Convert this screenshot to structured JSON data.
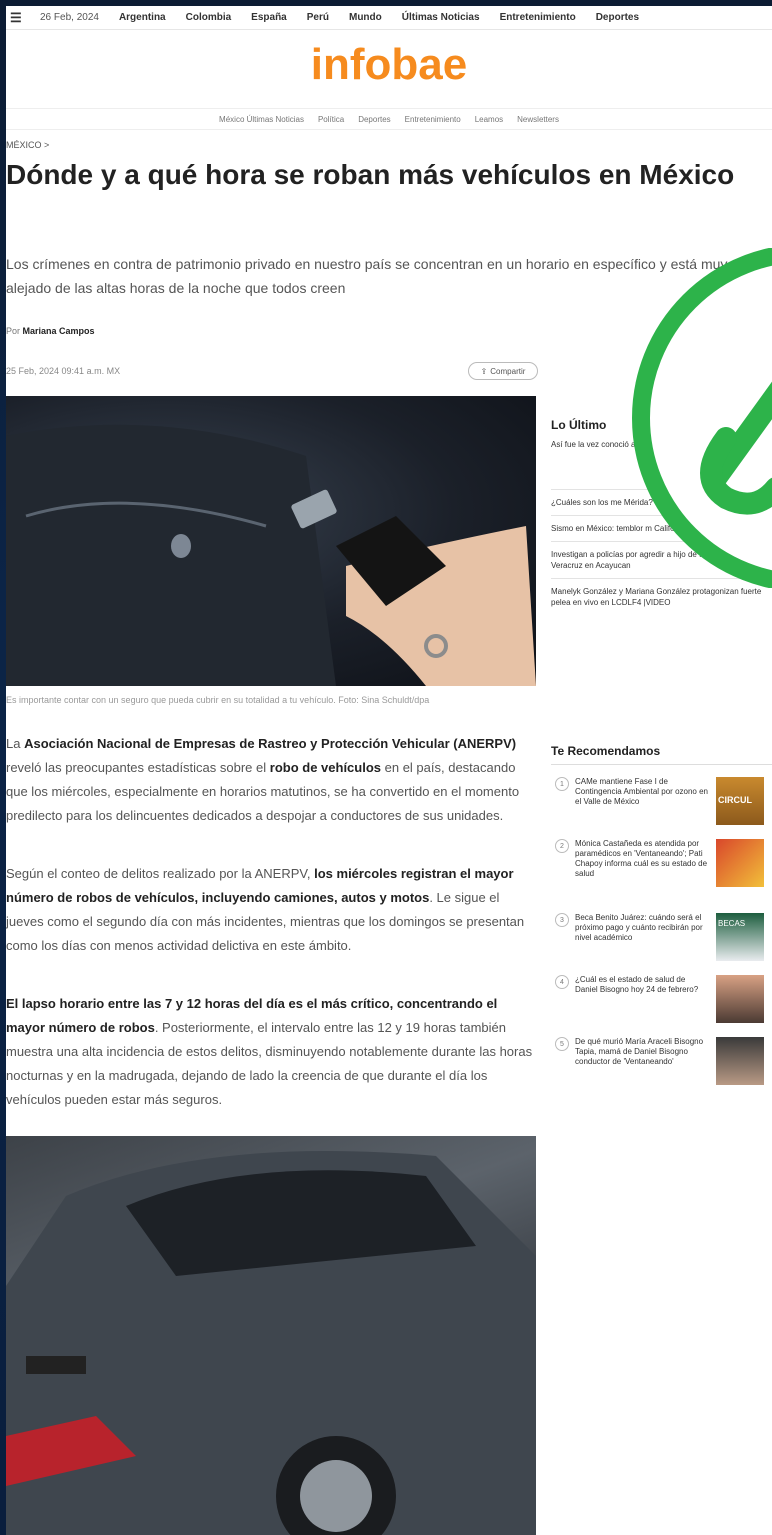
{
  "topbar": {
    "date": "26 Feb, 2024",
    "nav": [
      "Argentina",
      "Colombia",
      "España",
      "Perú",
      "Mundo",
      "Últimas Noticias",
      "Entretenimiento",
      "Deportes"
    ]
  },
  "logo": "infobae",
  "subnav": [
    "México Últimas Noticias",
    "Política",
    "Deportes",
    "Entretenimiento",
    "Leamos",
    "Newsletters"
  ],
  "breadcrumb": "MÉXICO >",
  "article": {
    "headline": "Dónde y a qué hora se roban más vehículos en México",
    "deck": "Los crímenes en contra de patrimonio privado en nuestro país se concentran en un horario en específico y está muy alejado de las altas horas de la noche que todos creen",
    "byline_prefix": "Por",
    "author": "Mariana Campos",
    "date": "25 Feb, 2024 09:41 a.m. MX",
    "share": "Compartir",
    "caption": "Es importante contar con un seguro que pueda cubrir en su totalidad a tu vehículo. Foto: Sina Schuldt/dpa",
    "p1": {
      "a": "La ",
      "b": "Asociación Nacional de Empresas de Rastreo y Protección Vehicular (ANERPV)",
      "c": " reveló las preocupantes estadísticas sobre el ",
      "d": "robo de vehículos",
      "e": " en el país, destacando que los miércoles, especialmente en horarios matutinos, se ha convertido en el momento predilecto para los delincuentes dedicados a despojar a conductores de sus unidades."
    },
    "p2": {
      "a": "Según el conteo de delitos realizado por la ANERPV, ",
      "b": "los miércoles registran el mayor número de robos de vehículos, incluyendo camiones, autos y motos",
      "c": ". Le sigue el jueves como el segundo día con más incidentes, mientras que los domingos se presentan como los días con menos actividad delictiva en este ámbito."
    },
    "p3": {
      "a": "El lapso horario entre las 7 y 12 horas del día es el más crítico, concentrando el mayor número de robos",
      "b": ". Posteriormente, el intervalo entre las 12 y 19 horas también muestra una alta incidencia de estos delitos, disminuyendo notablemente durante las horas nocturnas y en la madrugada, dejando de lado la creencia de que durante el día los vehículos pueden estar más seguros."
    }
  },
  "latest": {
    "title": "Lo Último",
    "items": [
      "Así fue la vez conoció a Che ídolo\"",
      "¿Cuáles son los me Mérida?",
      "Sismo en México: temblor m California",
      "Investigan a policías por agredir a hijo de fotoperiodista de Veracruz en Acayucan",
      "Manelyk González y Mariana González protagonizan fuerte pelea en vivo en LCDLF4 |VIDEO"
    ]
  },
  "recs": {
    "title": "Te Recomendamos",
    "items": [
      {
        "num": "1",
        "text": "CAMe mantiene Fase I de Contingencia Ambiental por ozono en el Valle de México"
      },
      {
        "num": "2",
        "text": "Mónica Castañeda es atendida por paramédicos en 'Ventaneando'; Pati Chapoy informa cuál es su estado de salud"
      },
      {
        "num": "3",
        "text": "Beca Benito Juárez: cuándo será el próximo pago y cuánto recibirán por nivel académico"
      },
      {
        "num": "4",
        "text": "¿Cuál es el estado de salud de Daniel Bisogno hoy 24 de febrero?"
      },
      {
        "num": "5",
        "text": "De qué murió María Araceli Bisogno Tapia, mamá de Daniel Bisogno conductor de 'Ventaneando'"
      }
    ],
    "thumb_labels": [
      "CIRCUL",
      "BECAS"
    ]
  },
  "colors": {
    "brand": "#f68b1e",
    "overlay": "#2db34a"
  }
}
